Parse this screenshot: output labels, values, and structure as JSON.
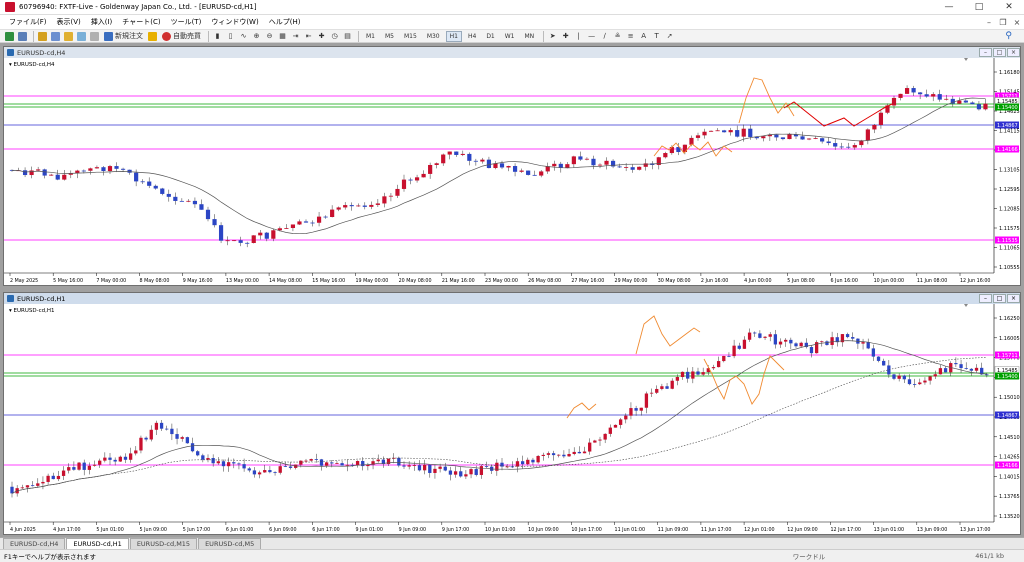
{
  "window": {
    "title": "60796940: FXTF-Live - Goldenway Japan Co., Ltd. - [EURUSD-cd,H1]"
  },
  "menu": [
    "ファイル(F)",
    "表示(V)",
    "挿入(I)",
    "チャート(C)",
    "ツール(T)",
    "ウィンドウ(W)",
    "ヘルプ(H)"
  ],
  "toolbar": {
    "new_order": "新規注文",
    "auto_trade": "自動売買",
    "timeframes": [
      "M1",
      "M5",
      "M15",
      "M30",
      "H1",
      "H4",
      "D1",
      "W1",
      "MN"
    ],
    "active_timeframe": "H1"
  },
  "chart_h4": {
    "caption": "EURUSD-cd,H4",
    "label": "EURUSD-cd,H4",
    "y_ticks": [
      "1.16180",
      "1.15145",
      "1.14625",
      "1.14115",
      "1.13615",
      "1.13105",
      "1.12595",
      "1.12085",
      "1.11575",
      "1.11065",
      "1.10555"
    ],
    "price_tags": [
      {
        "text": "1.15711",
        "color": "#ff00ff"
      },
      {
        "text": "1.15485",
        "color": "#ffffff"
      },
      {
        "text": "1.15400",
        "color": "#00a000"
      },
      {
        "text": "1.14867",
        "color": "#3030d0"
      },
      {
        "text": "1.14166",
        "color": "#ff00ff"
      },
      {
        "text": "1.11535",
        "color": "#ff00ff"
      }
    ],
    "x_ticks": [
      "2 May 2025",
      "5 May 16:00",
      "7 May 00:00",
      "8 May 08:00",
      "9 May 16:00",
      "13 May 00:00",
      "14 May 08:00",
      "15 May 16:00",
      "19 May 00:00",
      "20 May 08:00",
      "21 May 16:00",
      "23 May 00:00",
      "26 May 08:00",
      "27 May 16:00",
      "29 May 00:00",
      "30 May 08:00",
      "2 Jun 16:00",
      "4 Jun 00:00",
      "5 Jun 08:00",
      "6 Jun 16:00",
      "10 Jun 00:00",
      "11 Jun 08:00",
      "12 Jun 16:00"
    ]
  },
  "chart_h1": {
    "caption": "EURUSD-cd,H1",
    "label": "EURUSD-cd,H1",
    "y_ticks": [
      "1.16250",
      "1.16005",
      "1.15770",
      "1.15525",
      "1.15010",
      "1.14760",
      "1.14510",
      "1.14265",
      "1.14015",
      "1.13765",
      "1.13520"
    ],
    "price_tags": [
      {
        "text": "1.15711",
        "color": "#ff00ff"
      },
      {
        "text": "1.15485",
        "color": "#ffffff"
      },
      {
        "text": "1.15400",
        "color": "#00a000"
      },
      {
        "text": "1.14867",
        "color": "#3030d0"
      },
      {
        "text": "1.14166",
        "color": "#ff00ff"
      }
    ],
    "x_ticks": [
      "4 Jun 2025",
      "4 Jun 17:00",
      "5 Jun 01:00",
      "5 Jun 09:00",
      "5 Jun 17:00",
      "6 Jun 01:00",
      "6 Jun 09:00",
      "6 Jun 17:00",
      "9 Jun 01:00",
      "9 Jun 09:00",
      "9 Jun 17:00",
      "10 Jun 01:00",
      "10 Jun 09:00",
      "10 Jun 17:00",
      "11 Jun 01:00",
      "11 Jun 09:00",
      "11 Jun 17:00",
      "12 Jun 01:00",
      "12 Jun 09:00",
      "12 Jun 17:00",
      "13 Jun 01:00",
      "13 Jun 09:00",
      "13 Jun 17:00"
    ]
  },
  "tabs": [
    {
      "label": "EURUSD-cd,H4",
      "active": false
    },
    {
      "label": "EURUSD-cd,H1",
      "active": true
    },
    {
      "label": "EURUSD-cd,M15",
      "active": false
    },
    {
      "label": "EURUSD-cd,M5",
      "active": false
    }
  ],
  "status": {
    "help": "F1キーでヘルプが表示されます",
    "profile": "ワークドル",
    "conn": "461/1 kb"
  },
  "colors": {
    "bull": "#c8102e",
    "bear": "#2b45c4",
    "magenta": "#ff00ff",
    "green": "#00a000",
    "blue": "#3030d0",
    "ma": "#555555",
    "forecast": "#e00000",
    "swing": "#f08a30"
  }
}
